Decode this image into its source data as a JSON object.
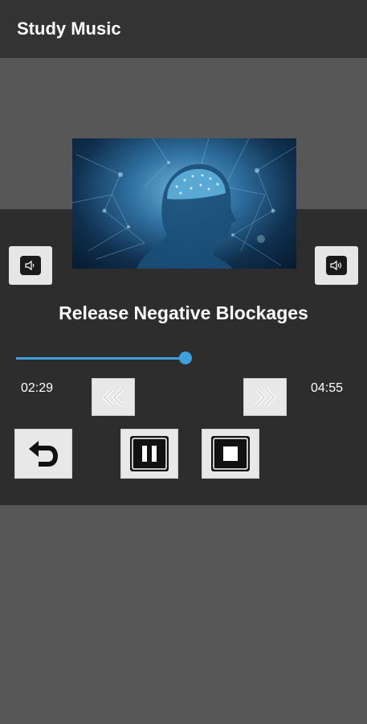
{
  "app": {
    "title": "Study Music"
  },
  "player": {
    "track_title": "Release Negative Blockages",
    "elapsed": "02:29",
    "duration": "04:55",
    "progress_fraction": 0.505
  },
  "colors": {
    "appbar": "#333333",
    "panel": "#2d2d2d",
    "background": "#575757",
    "accent": "#3f9fdb",
    "button": "#e8e8e8"
  },
  "icons": {
    "volume_left": "speaker-icon",
    "volume_right": "speaker-icon",
    "rewind": "double-chevron-left-icon",
    "forward": "double-chevron-right-icon",
    "back": "return-arrow-icon",
    "pause": "pause-icon",
    "stop": "stop-icon"
  }
}
